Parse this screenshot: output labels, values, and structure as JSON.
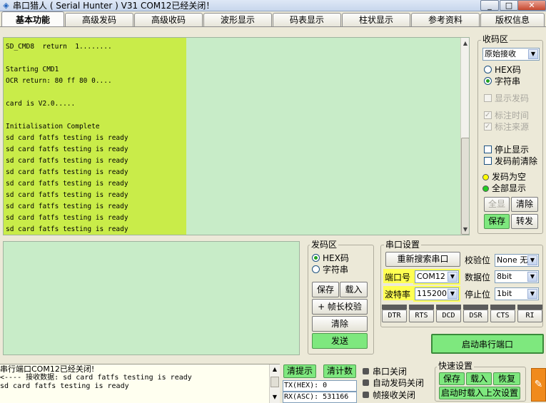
{
  "window": {
    "title": "串口猎人 ( Serial Hunter ) V31     COM12已经关闭！",
    "minimize": "_",
    "maximize": "□",
    "close": "✕"
  },
  "tabs": [
    {
      "label": "基本功能",
      "active": true
    },
    {
      "label": "高级发码",
      "active": false
    },
    {
      "label": "高级收码",
      "active": false
    },
    {
      "label": "波形显示",
      "active": false
    },
    {
      "label": "码表显示",
      "active": false
    },
    {
      "label": "柱状显示",
      "active": false
    },
    {
      "label": "参考资料",
      "active": false
    },
    {
      "label": "版权信息",
      "active": false
    }
  ],
  "receive": {
    "text": "SD_CMD8  return  1........\n\nStarting CMD1\nOCR return: 80 ff 80 0....\n\ncard is V2.0.....\n\nInitialisation Complete\nsd card fatfs testing is ready\nsd card fatfs testing is ready\nsd card fatfs testing is ready\nsd card fatfs testing is ready\nsd card fatfs testing is ready\nsd card fatfs testing is ready\nsd card fatfs testing is ready\nsd card fatfs testing is ready\nsd card fatfs testing is ready"
  },
  "recv_panel": {
    "title": "收码区",
    "mode": "原始接收",
    "hex_label": "HEX码",
    "text_label": "字符串",
    "show_send_label": "显示发码",
    "mark_time_label": "标注时间",
    "mark_source_label": "标注来源",
    "stop_display_label": "停止显示",
    "clear_before_send_label": "发码前清除",
    "send_empty_label": "发码为空",
    "show_all_label": "全部显示",
    "show_all_btn": "全显",
    "clear_btn": "清除",
    "save_btn": "保存",
    "forward_btn": "转发"
  },
  "send_panel": {
    "title": "发码区",
    "hex_label": "HEX码",
    "text_label": "字符串",
    "save_btn": "保存",
    "load_btn": "载入",
    "checksum_btn": "+ 帧长校验",
    "clear_btn": "清除",
    "send_btn": "发送"
  },
  "serial_settings": {
    "title": "串口设置",
    "rescan_btn": "重新搜索串口",
    "parity_label": "校验位",
    "parity_value": "None 无",
    "port_label": "端口号",
    "port_value": "COM12",
    "databits_label": "数据位",
    "databits_value": "8bit",
    "baud_label": "波特率",
    "baud_value": "115200",
    "stopbits_label": "停止位",
    "stopbits_value": "1bit",
    "signals": [
      "DTR",
      "RTS",
      "DCD",
      "DSR",
      "CTS",
      "RI"
    ],
    "start_btn": "启动串行端口"
  },
  "status": {
    "log_lines": [
      "串行端口COM12已经关闭!",
      "<---- 接收数据: sd card fatfs testing is ready",
      "sd card fatfs testing is ready"
    ],
    "clear_hint_btn": "清提示",
    "clear_count_btn": "清计数",
    "tx_counter": "TX(HEX): 0",
    "rx_counter": "RX(ASC): 531166",
    "port_closed": "串口关闭",
    "auto_send_closed": "自动发码关闭",
    "frame_recv_closed": "帧接收关闭"
  },
  "quick_settings": {
    "title": "快速设置",
    "save_btn": "保存",
    "load_btn": "载入",
    "restore_btn": "恢复",
    "load_last_btn": "启动时载入上次设置"
  },
  "colors": {
    "recv_bg": "#c8ecc8",
    "highlight": "#c9ec49",
    "green_button": "#7ee87e",
    "send_empty_dot": "#ffff00",
    "show_all_dot": "#22cc22",
    "tool_icon_bg": "#f08a1c"
  },
  "icons": {
    "app": "serial-hunter-icon",
    "tool": "tool-settings-icon"
  }
}
